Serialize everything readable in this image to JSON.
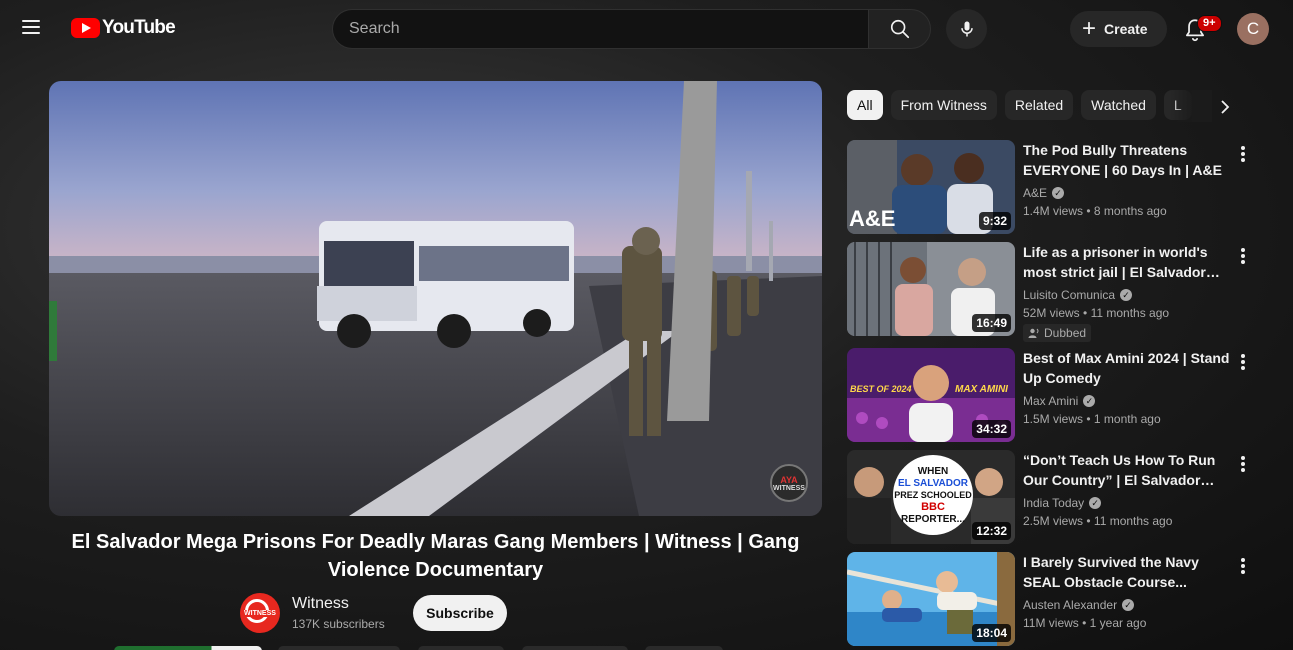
{
  "header": {
    "logo_text": "YouTube",
    "search_placeholder": "Search",
    "create_label": "Create",
    "notification_count": "9+",
    "avatar_letter": "C"
  },
  "player": {
    "watermark_top": "AYA",
    "watermark_bottom": "WITNESS"
  },
  "video": {
    "title": "El Salvador Mega Prisons For Deadly Maras Gang Members | Witness | Gang Violence Documentary",
    "channel": {
      "avatar_text": "WITNESS",
      "name": "Witness",
      "subscribers": "137K subscribers"
    },
    "subscribe_label": "Subscribe"
  },
  "chips": [
    {
      "label": "All",
      "active": true
    },
    {
      "label": "From Witness",
      "active": false
    },
    {
      "label": "Related",
      "active": false
    },
    {
      "label": "Watched",
      "active": false
    },
    {
      "label": "L",
      "active": false
    }
  ],
  "related": [
    {
      "title": "The Pod Bully Threatens EVERYONE | 60 Days In | A&E",
      "channel": "A&E",
      "views": "1.4M views",
      "age": "8 months ago",
      "duration": "9:32",
      "thumb_text": "A&E"
    },
    {
      "title": "Life as a prisoner in world's most strict jail | El Salvador…",
      "channel": "Luisito Comunica",
      "views": "52M views",
      "age": "11 months ago",
      "duration": "16:49",
      "badge": "Dubbed"
    },
    {
      "title": "Best of Max Amini 2024 | Stand Up Comedy",
      "channel": "Max Amini",
      "views": "1.5M views",
      "age": "1 month ago",
      "duration": "34:32",
      "thumb_text_left": "BEST OF 2024",
      "thumb_text_right": "MAX AMINI"
    },
    {
      "title": "“Don’t Teach Us How To Run Our Country” | El Salvador…",
      "channel": "India Today",
      "views": "2.5M views",
      "age": "11 months ago",
      "duration": "12:32",
      "thumb_lines": [
        "WHEN",
        "EL SALVADOR",
        "PREZ SCHOOLED",
        "BBC",
        "REPORTER..."
      ]
    },
    {
      "title": "I Barely Survived the Navy SEAL Obstacle Course...",
      "channel": "Austen Alexander",
      "views": "11M views",
      "age": "1 year ago",
      "duration": "18:04"
    }
  ]
}
